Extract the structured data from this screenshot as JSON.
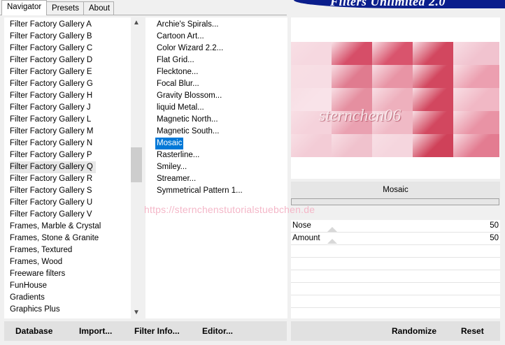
{
  "tabs": [
    "Navigator",
    "Presets",
    "About"
  ],
  "banner_title": "Filters Unlimited 2.0",
  "categories": [
    "Filter Factory Gallery A",
    "Filter Factory Gallery B",
    "Filter Factory Gallery C",
    "Filter Factory Gallery D",
    "Filter Factory Gallery E",
    "Filter Factory Gallery G",
    "Filter Factory Gallery H",
    "Filter Factory Gallery J",
    "Filter Factory Gallery L",
    "Filter Factory Gallery M",
    "Filter Factory Gallery N",
    "Filter Factory Gallery P",
    "Filter Factory Gallery Q",
    "Filter Factory Gallery R",
    "Filter Factory Gallery S",
    "Filter Factory Gallery U",
    "Filter Factory Gallery V",
    "Frames, Marble & Crystal",
    "Frames, Stone & Granite",
    "Frames, Textured",
    "Frames, Wood",
    "Freeware filters",
    "FunHouse",
    "Gradients",
    "Graphics Plus"
  ],
  "selected_category": "Filter Factory Gallery Q",
  "filters": [
    "Archie's Spirals...",
    "Cartoon Art...",
    "Color Wizard 2.2...",
    "Flat Grid...",
    "Flecktone...",
    "Focal Blur...",
    "Gravity Blossom...",
    "liquid Metal...",
    "Magnetic North...",
    "Magnetic South...",
    "Mosaic",
    "Rasterline...",
    "Smiley...",
    "Streamer...",
    "Symmetrical Pattern 1..."
  ],
  "selected_filter": "Mosaic",
  "preview": {
    "watermark": "sternchen06"
  },
  "filter_name": "Mosaic",
  "params": [
    {
      "label": "Nose",
      "value": "50"
    },
    {
      "label": "Amount",
      "value": "50"
    }
  ],
  "url_watermark": "https://sternchenstutorialstuebchen.de",
  "buttons": {
    "database": "Database",
    "import": "Import...",
    "filter_info": "Filter Info...",
    "editor": "Editor...",
    "randomize": "Randomize",
    "reset": "Reset"
  },
  "colors": {
    "selection": "#0078d7",
    "banner": "#0b1e8c",
    "preview_dark": "#d2475f",
    "preview_light": "#f4d3dc"
  }
}
